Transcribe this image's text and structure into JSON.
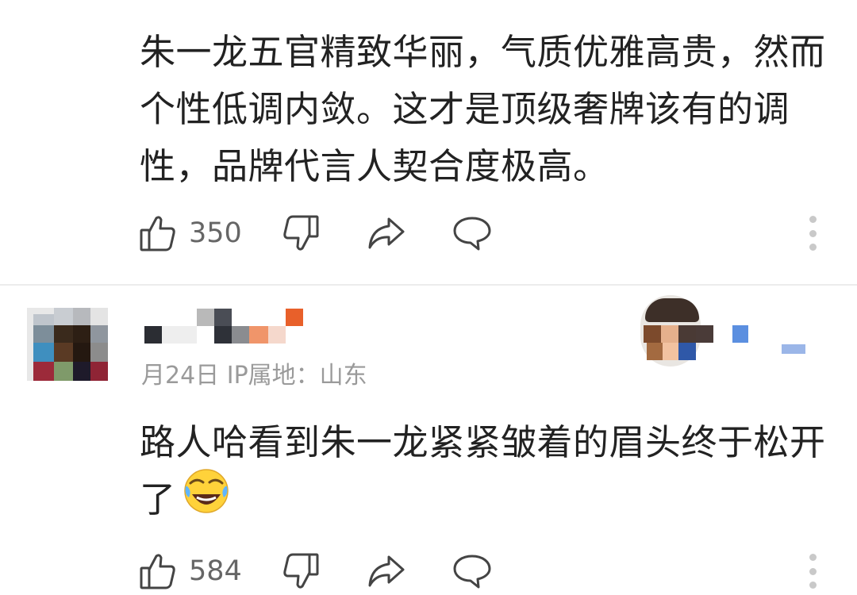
{
  "comments": [
    {
      "text": "朱一龙五官精致华丽，气质优雅高贵，然而个性低调内敛。这才是顶级奢牌该有的调性，品牌代言人契合度极高。",
      "likes": "350",
      "icons": {
        "like": "thumbs-up-icon",
        "dislike": "thumbs-down-icon",
        "share": "share-arrow-icon",
        "reply": "speech-bubble-icon",
        "more": "more-vertical-icon"
      }
    },
    {
      "date": "月24日",
      "ip_label": "IP属地：山东",
      "text": "路人哈看到朱一龙紧紧皱着的眉头终于松开了",
      "emoji": "laughing-tears-emoji",
      "likes": "584"
    }
  ],
  "colors": {
    "text": "#222222",
    "meta": "#9a9a9a",
    "icon": "#444444",
    "divider": "#ececec"
  }
}
